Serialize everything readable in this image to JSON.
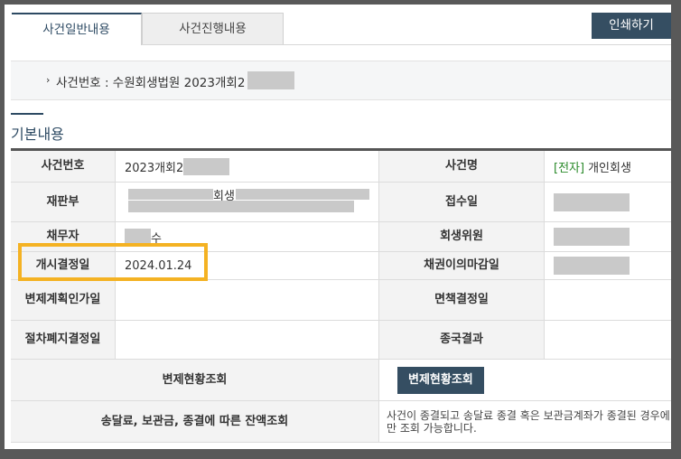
{
  "tabs": [
    {
      "label": "사건일반내용",
      "active": true
    },
    {
      "label": "사건진행내용",
      "active": false
    }
  ],
  "print_button": "인쇄하기",
  "case_bar": {
    "bullet": "›",
    "label": "사건번호 : 수원회생법원 2023개회2"
  },
  "section_title": "기본내용",
  "fields": {
    "case_no_label": "사건번호",
    "case_no_value": "2023개회2",
    "case_name_label": "사건명",
    "case_name_tag": "[전자]",
    "case_name_value": "개인회생",
    "court_label": "재판부",
    "court_value_suffix": "회생",
    "received_label": "접수일",
    "debtor_label": "채무자",
    "debtor_value_suffix": "수",
    "commissioner_label": "회생위원",
    "start_decision_label": "개시결정일",
    "start_decision_value": "2024.01.24",
    "claim_deadline_label": "채권이의마감일",
    "repayment_plan_label": "변제계획인가일",
    "discharge_label": "면책결정일",
    "abolish_label": "절차폐지결정일",
    "final_result_label": "종국결과",
    "repayment_status_label": "변제현황조회",
    "repayment_status_button": "변제현황조회",
    "balance_label": "송달료, 보관금, 종결에 따른 잔액조회",
    "balance_note": "사건이 종결되고 송달료 종결 혹은 보관금계좌가 종결된 경우에만 조회 가능합니다."
  },
  "colors": {
    "accent": "#354e62",
    "highlight": "#f4b223",
    "green": "#2a8a2a"
  }
}
